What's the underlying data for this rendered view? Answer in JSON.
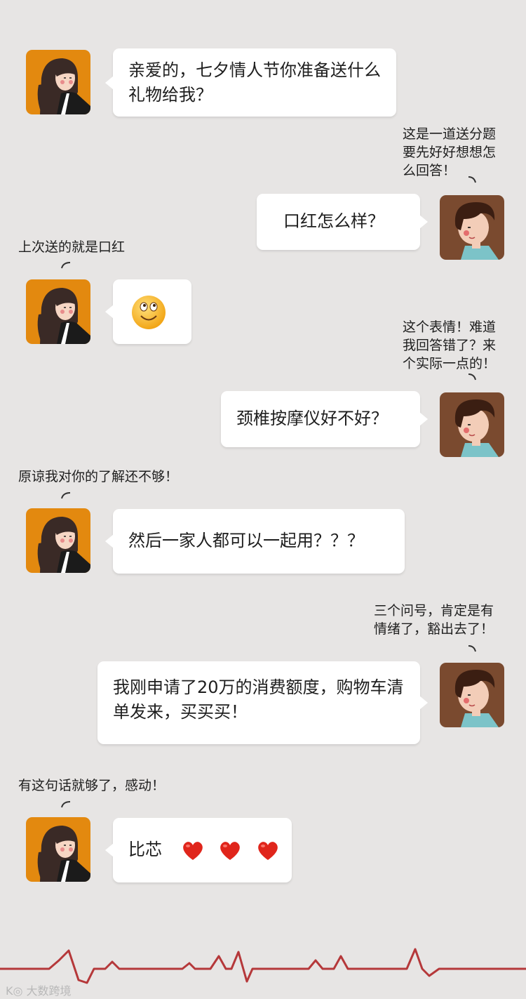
{
  "messages": [
    {
      "from": "her",
      "text": "亲爱的，七夕情人节你准备送什么礼物给我？"
    },
    {
      "from": "him",
      "note": "这是一道送分题\n要先好好想想怎\n么回答！",
      "text": "口红怎么样？"
    },
    {
      "from": "her",
      "note": "上次送的就是口红",
      "emoji": "smile-emoji"
    },
    {
      "from": "him",
      "note": "这个表情！难道\n我回答错了？来\n个实际一点的！",
      "text": "颈椎按摩仪好不好？"
    },
    {
      "from": "her",
      "note": "原谅我对你的了解还不够！",
      "text": "然后一家人都可以一起用？？？"
    },
    {
      "from": "him",
      "note": "三个问号，肯定是有\n情绪了，豁出去了！",
      "text": "我刚申请了20万的消费额度，购物车清单发来，买买买！"
    },
    {
      "from": "her",
      "note": "有这句话就够了，感动！",
      "text": "比芯",
      "hearts": 3
    }
  ],
  "watermark": "大数跨境",
  "colors": {
    "background": "#e7e5e4",
    "bubble": "#ffffff",
    "her_avatar_bg": "#e3890f",
    "him_avatar_bg": "#7a4a2f",
    "heartbeat_line": "#b5383a",
    "heart": "#e0251b"
  }
}
